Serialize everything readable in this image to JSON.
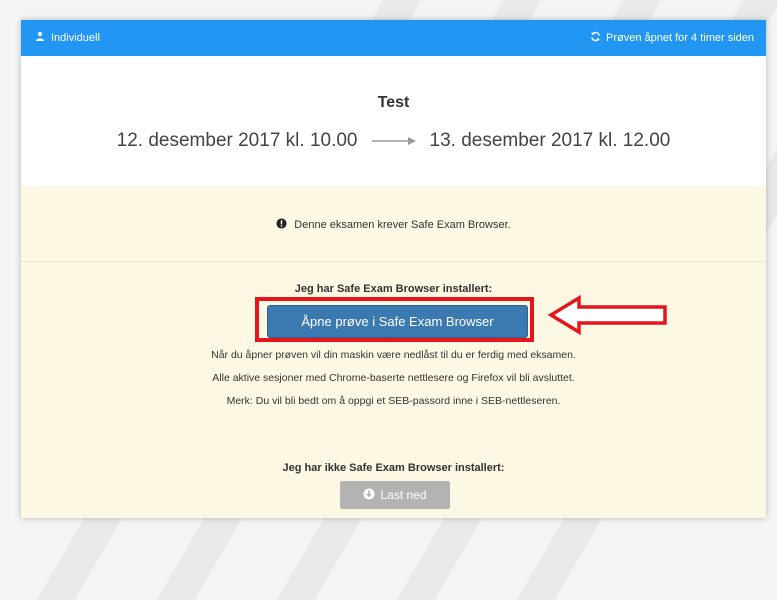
{
  "header": {
    "mode_label": "Individuell",
    "status_label": "Prøven åpnet for 4 timer siden"
  },
  "exam": {
    "title": "Test",
    "start": "12. desember 2017 kl. 10.00",
    "end": "13. desember 2017 kl. 12.00"
  },
  "notice": {
    "text": "Denne eksamen krever Safe Exam Browser."
  },
  "installed": {
    "heading": "Jeg har Safe Exam Browser installert:",
    "button_label": "Åpne prøve i Safe Exam Browser",
    "info_lines": [
      "Når du åpner prøven vil din maskin være nedlåst til du er ferdig med eksamen.",
      "Alle aktive sesjoner med Chrome-baserte nettlesere og Firefox vil bli avsluttet.",
      "Merk: Du vil bli bedt om å oppgi et SEB-passord inne i SEB-nettleseren."
    ]
  },
  "not_installed": {
    "heading": "Jeg har ikke Safe Exam Browser installert:",
    "button_label": "Last ned"
  },
  "icons": {
    "user": "user-icon",
    "refresh": "refresh-icon",
    "arrow": "long-arrow-right-icon",
    "info": "info-circle-icon",
    "download": "download-circle-icon",
    "annotation_arrow": "red-arrow-icon"
  },
  "colors": {
    "header": "#2196f3",
    "primary_button": "#3b7ab0",
    "notice_background": "#fcf8e3",
    "annotation": "#e4161c",
    "disabled_button": "#b3b3b3"
  }
}
